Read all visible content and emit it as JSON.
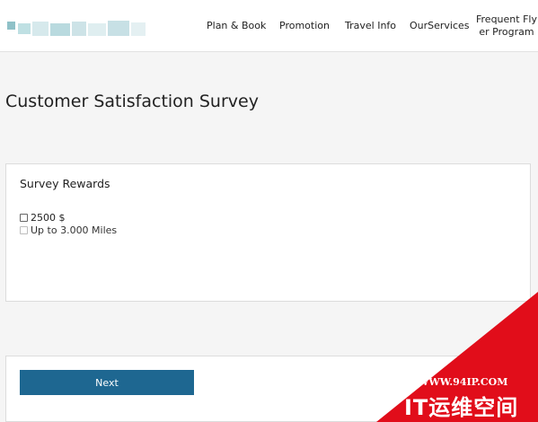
{
  "nav": {
    "items": [
      "Plan & Book",
      "Promotion",
      "Travel Info",
      "OurServices"
    ],
    "ffp_line1": "Frequent Fly",
    "ffp_line2": "er Program"
  },
  "page": {
    "title": "Customer Satisfaction Survey"
  },
  "rewards": {
    "title": "Survey Rewards",
    "options": [
      {
        "label": "2500 $",
        "checked": false
      },
      {
        "label": "Up to 3.000 Miles",
        "checked": false
      }
    ]
  },
  "actions": {
    "next_label": "Next"
  },
  "watermark": {
    "url": "WWW.94IP.COM",
    "brand": "IT运维空间"
  },
  "colors": {
    "primary_button": "#1e6791",
    "page_background": "#f5f5f5",
    "watermark_red": "#e10d1a"
  }
}
